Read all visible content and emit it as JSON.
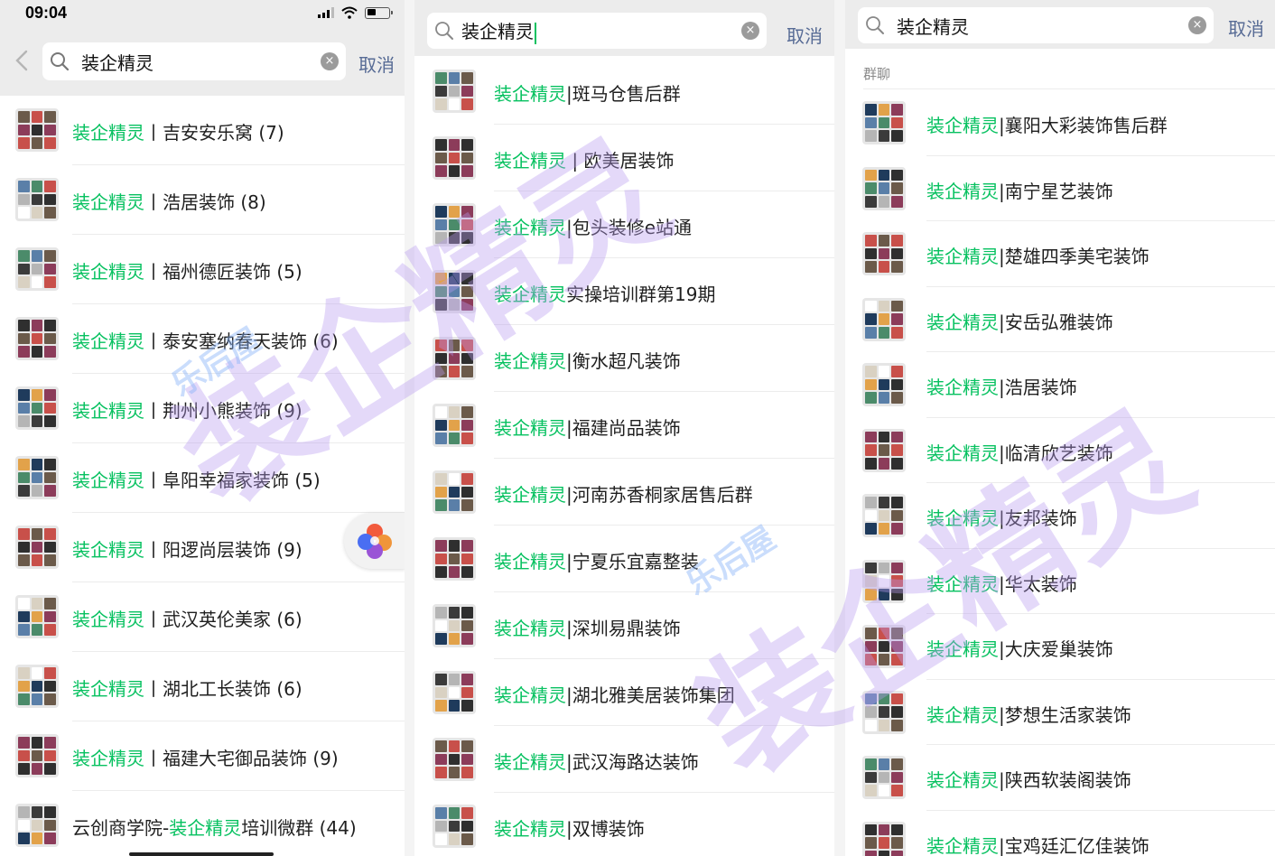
{
  "status_bar": {
    "time": "09:04"
  },
  "search": {
    "query": "装企精灵",
    "cancel_label": "取消",
    "clear_glyph": "×"
  },
  "highlight_color": "#07c160",
  "link_color": "#576b95",
  "panel1": {
    "results": [
      {
        "pre": "",
        "hl": "装企精灵",
        "post": "丨吉安安乐窝 (7)"
      },
      {
        "pre": "",
        "hl": "装企精灵",
        "post": "丨浩居装饰 (8)"
      },
      {
        "pre": "",
        "hl": "装企精灵",
        "post": "丨福州德匠装饰 (5)"
      },
      {
        "pre": "",
        "hl": "装企精灵",
        "post": "丨泰安塞纳春天装饰 (6)"
      },
      {
        "pre": "",
        "hl": "装企精灵",
        "post": "丨荆州小熊装饰 (9)"
      },
      {
        "pre": "",
        "hl": "装企精灵",
        "post": "丨阜阳幸福家装饰 (5)"
      },
      {
        "pre": "",
        "hl": "装企精灵",
        "post": "丨阳逻尚层装饰 (9)"
      },
      {
        "pre": "",
        "hl": "装企精灵",
        "post": "丨武汉英伦美家 (6)"
      },
      {
        "pre": "",
        "hl": "装企精灵",
        "post": "丨湖北工长装饰 (6)"
      },
      {
        "pre": "",
        "hl": "装企精灵",
        "post": "丨福建大宅御品装饰 (9)"
      },
      {
        "pre": "云创商学院-",
        "hl": "装企精灵",
        "post": "培训微群 (44)"
      }
    ]
  },
  "panel2": {
    "results": [
      {
        "hl": "装企精灵",
        "post": "|斑马仓售后群"
      },
      {
        "hl": "装企精灵",
        "post": " | 欧美居装饰"
      },
      {
        "hl": "装企精灵",
        "post": "|包头装修e站通"
      },
      {
        "hl": "装企精灵",
        "post": "实操培训群第19期"
      },
      {
        "hl": "装企精灵",
        "post": "|衡水超凡装饰"
      },
      {
        "hl": "装企精灵",
        "post": "|福建尚品装饰"
      },
      {
        "hl": "装企精灵",
        "post": "|河南苏香桐家居售后群"
      },
      {
        "hl": "装企精灵",
        "post": "|宁夏乐宜嘉整装"
      },
      {
        "hl": "装企精灵",
        "post": "|深圳易鼎装饰"
      },
      {
        "hl": "装企精灵",
        "post": "|湖北雅美居装饰集团"
      },
      {
        "hl": "装企精灵",
        "post": "|武汉海路达装饰"
      },
      {
        "hl": "装企精灵",
        "post": "|双博装饰"
      }
    ]
  },
  "panel3": {
    "section_header": "群聊",
    "results": [
      {
        "hl": "装企精灵",
        "post": "|襄阳大彩装饰售后群"
      },
      {
        "hl": "装企精灵",
        "post": "|南宁星艺装饰"
      },
      {
        "hl": "装企精灵",
        "post": "|楚雄四季美宅装饰"
      },
      {
        "hl": "装企精灵",
        "post": "|安岳弘雅装饰"
      },
      {
        "hl": "装企精灵",
        "post": "|浩居装饰"
      },
      {
        "hl": "装企精灵",
        "post": "|临清欣艺装饰"
      },
      {
        "hl": "装企精灵",
        "post": "|友邦装饰"
      },
      {
        "hl": "装企精灵",
        "post": "|华太装饰"
      },
      {
        "hl": "装企精灵",
        "post": "|大庆爱巢装饰"
      },
      {
        "hl": "装企精灵",
        "post": "|梦想生活家装饰"
      },
      {
        "hl": "装企精灵",
        "post": "|陕西软装阁装饰"
      },
      {
        "hl": "装企精灵",
        "post": "|宝鸡廷汇亿佳装饰"
      }
    ]
  },
  "watermark": {
    "large": "装企精灵",
    "small": "乐后屋"
  },
  "icons": [
    "back-icon",
    "search-icon",
    "clear-icon",
    "signal-icon",
    "wifi-icon",
    "battery-icon",
    "floating-window-icon"
  ]
}
